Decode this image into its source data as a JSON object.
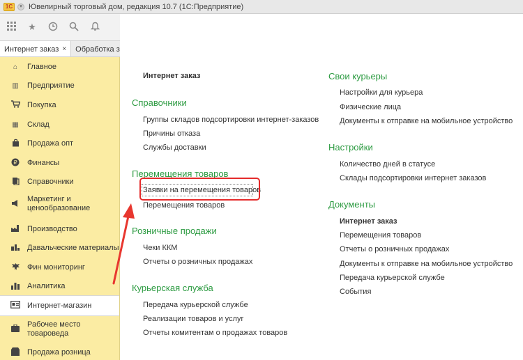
{
  "window": {
    "logo_text": "1C",
    "title": "Ювелирный торговый дом, редакция 10.7  (1С:Предприятие)"
  },
  "toolbar": {
    "icons": [
      "apps-grid-icon",
      "star-icon",
      "history-icon",
      "search-icon",
      "bell-icon"
    ]
  },
  "tabs": [
    {
      "label": "Интернет заказ",
      "active": true,
      "close": "×"
    },
    {
      "label": "Обработка за",
      "active": false
    }
  ],
  "sidebar": {
    "items": [
      {
        "label": "Главное",
        "icon": "home-icon"
      },
      {
        "label": "Предприятие",
        "icon": "building-icon"
      },
      {
        "label": "Покупка",
        "icon": "cart-icon"
      },
      {
        "label": "Склад",
        "icon": "warehouse-icon"
      },
      {
        "label": "Продажа опт",
        "icon": "bag-icon"
      },
      {
        "label": "Финансы",
        "icon": "coin-icon"
      },
      {
        "label": "Справочники",
        "icon": "book-icon"
      },
      {
        "label": "Маркетинг и ценообразование",
        "icon": "marketing-icon"
      },
      {
        "label": "Производство",
        "icon": "factory-icon"
      },
      {
        "label": "Давальческие материалы",
        "icon": "materials-icon"
      },
      {
        "label": "Фин мониторинг",
        "icon": "eagle-icon"
      },
      {
        "label": "Аналитика",
        "icon": "chart-icon"
      },
      {
        "label": "Интернет-магазин",
        "icon": "webshop-icon",
        "active": true
      },
      {
        "label": "Рабочее место товароведа",
        "icon": "workplace-icon"
      },
      {
        "label": "Продажа розница",
        "icon": "retail-icon"
      }
    ]
  },
  "main": {
    "left": {
      "top_link": "Интернет заказ",
      "sections": [
        {
          "title": "Справочники",
          "links": [
            "Группы складов подсортировки интернет-заказов",
            "Причины отказа",
            "Службы доставки"
          ]
        },
        {
          "title": "Перемещения товаров",
          "links": [
            "Заявки на перемещения товаров",
            "Перемещения товаров"
          ]
        },
        {
          "title": "Розничные продажи",
          "links": [
            "Чеки ККМ",
            "Отчеты о розничных продажах"
          ]
        },
        {
          "title": "Курьерская служба",
          "links": [
            "Передача курьерской службе",
            "Реализации товаров и услуг",
            "Отчеты комитентам о продажах товаров"
          ]
        }
      ]
    },
    "right": {
      "sections": [
        {
          "title": "Свои курьеры",
          "links": [
            "Настройки для курьера",
            "Физические лица",
            "Документы к отправке на мобильное устройство"
          ]
        },
        {
          "title": "Настройки",
          "links": [
            "Количество дней в статусе",
            "Склады подсортировки интернет заказов"
          ]
        },
        {
          "title": "Документы",
          "links": [
            "Интернет заказ",
            "Перемещения товаров",
            "Отчеты о розничных продажах",
            "Документы к отправке на мобильное устройство",
            "Передача курьерской службе",
            "События"
          ]
        }
      ]
    }
  },
  "annotation": {
    "box_color": "#e52b2b",
    "arrow_color": "#e8372f"
  },
  "colors": {
    "sidebar_bg": "#fbeca3",
    "section_green": "#2d9b42"
  }
}
